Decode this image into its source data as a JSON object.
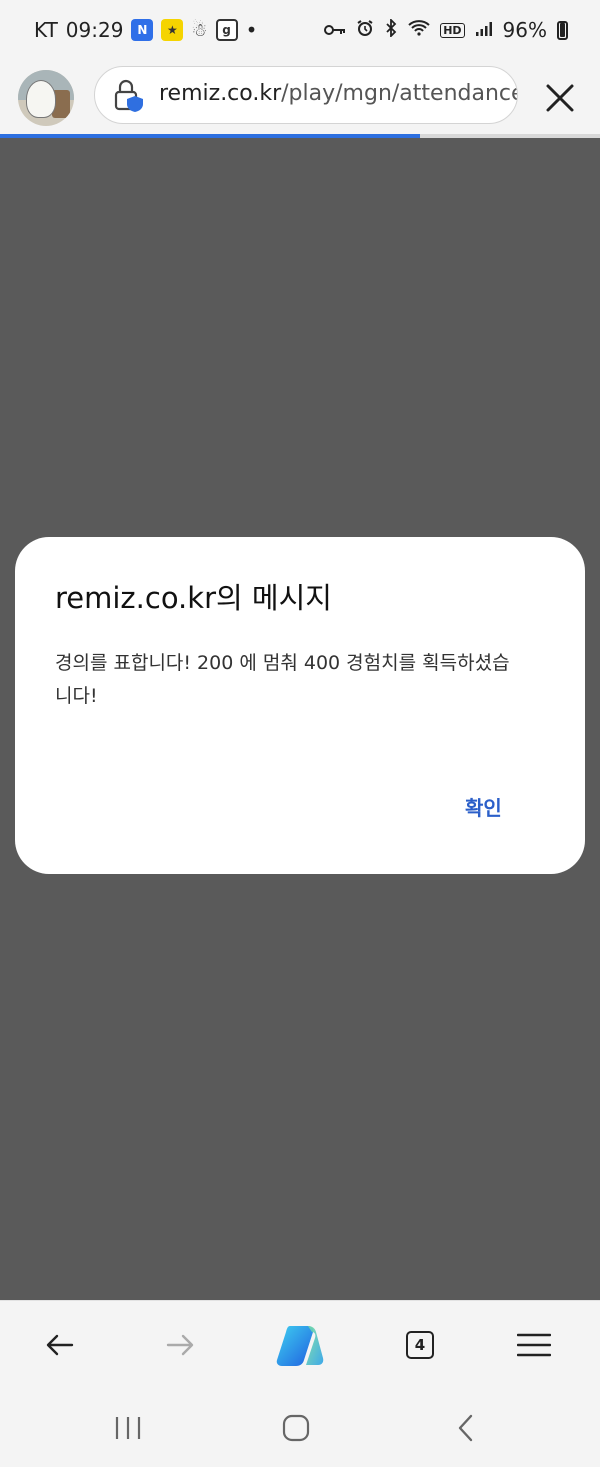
{
  "status_bar": {
    "carrier": "KT",
    "time": "09:29",
    "notification_icons": [
      "news-app-icon",
      "kakao-app-icon",
      "mascot-app-icon",
      "g-app-icon"
    ],
    "dot": "•",
    "hd_label": "HD",
    "battery": "96%"
  },
  "browser": {
    "url_host": "remiz.co.kr",
    "url_path": "/play/mgn/attendance",
    "load_progress": 0.7
  },
  "dialog": {
    "title": "remiz.co.kr의 메시지",
    "message": "경의를 표합니다! 200 에 멈춰 400 경험치를 획득하셨습니다!",
    "ok_label": "확인"
  },
  "toolbar": {
    "tab_count": "4"
  },
  "colors": {
    "accent": "#2b5fc9",
    "progress": "#2d6fe0",
    "overlay": "#5a5a5a"
  }
}
